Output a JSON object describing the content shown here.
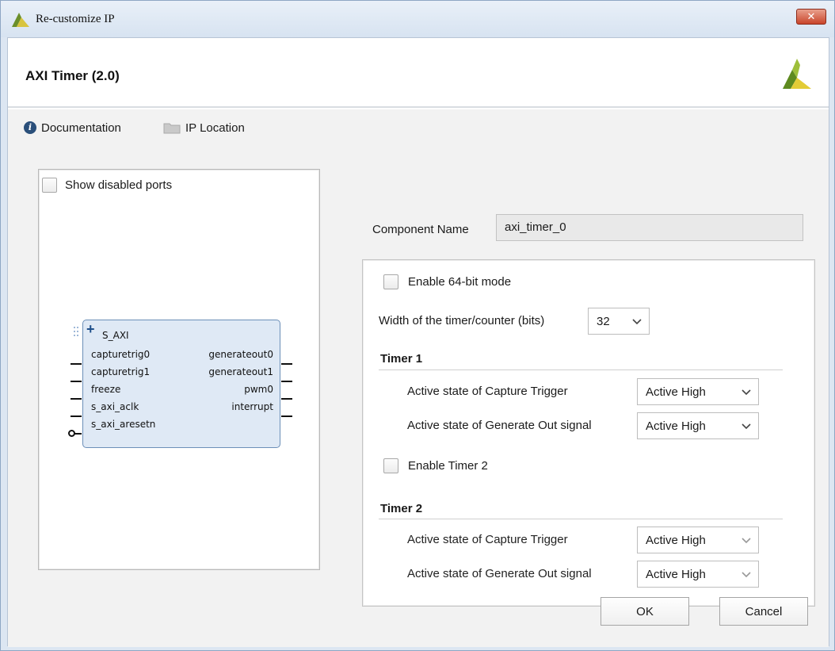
{
  "window": {
    "title": "Re-customize IP",
    "close_glyph": "✕"
  },
  "header": {
    "ip_title": "AXI Timer (2.0)"
  },
  "links": {
    "documentation": "Documentation",
    "ip_location": "IP Location"
  },
  "symbol_panel": {
    "show_disabled_ports_label": "Show disabled ports",
    "show_disabled_ports_checked": false,
    "block": {
      "bus_interface": "S_AXI",
      "left_ports": [
        "capturetrig0",
        "capturetrig1",
        "freeze",
        "s_axi_aclk",
        "s_axi_aresetn"
      ],
      "right_ports": [
        "generateout0",
        "generateout1",
        "pwm0",
        "interrupt"
      ]
    }
  },
  "config": {
    "component_name_label": "Component Name",
    "component_name_value": "axi_timer_0",
    "enable_64bit_label": "Enable 64-bit mode",
    "enable_64bit_checked": false,
    "width_label": "Width of the timer/counter (bits)",
    "width_value": "32",
    "timer1": {
      "title": "Timer 1",
      "capture_label": "Active state of Capture Trigger",
      "capture_value": "Active High",
      "generate_label": "Active state of Generate Out signal",
      "generate_value": "Active High"
    },
    "enable_timer2_label": "Enable Timer 2",
    "enable_timer2_checked": false,
    "timer2": {
      "title": "Timer 2",
      "capture_label": "Active state of Capture Trigger",
      "capture_value": "Active High",
      "generate_label": "Active state of Generate Out signal",
      "generate_value": "Active High"
    }
  },
  "buttons": {
    "ok": "OK",
    "cancel": "Cancel"
  },
  "colors": {
    "brand_green": "#8db53c",
    "brand_dark": "#c9b83a",
    "close_red": "#c9452b",
    "block_fill": "#dfe9f5",
    "info_blue": "#2a4f7a"
  }
}
